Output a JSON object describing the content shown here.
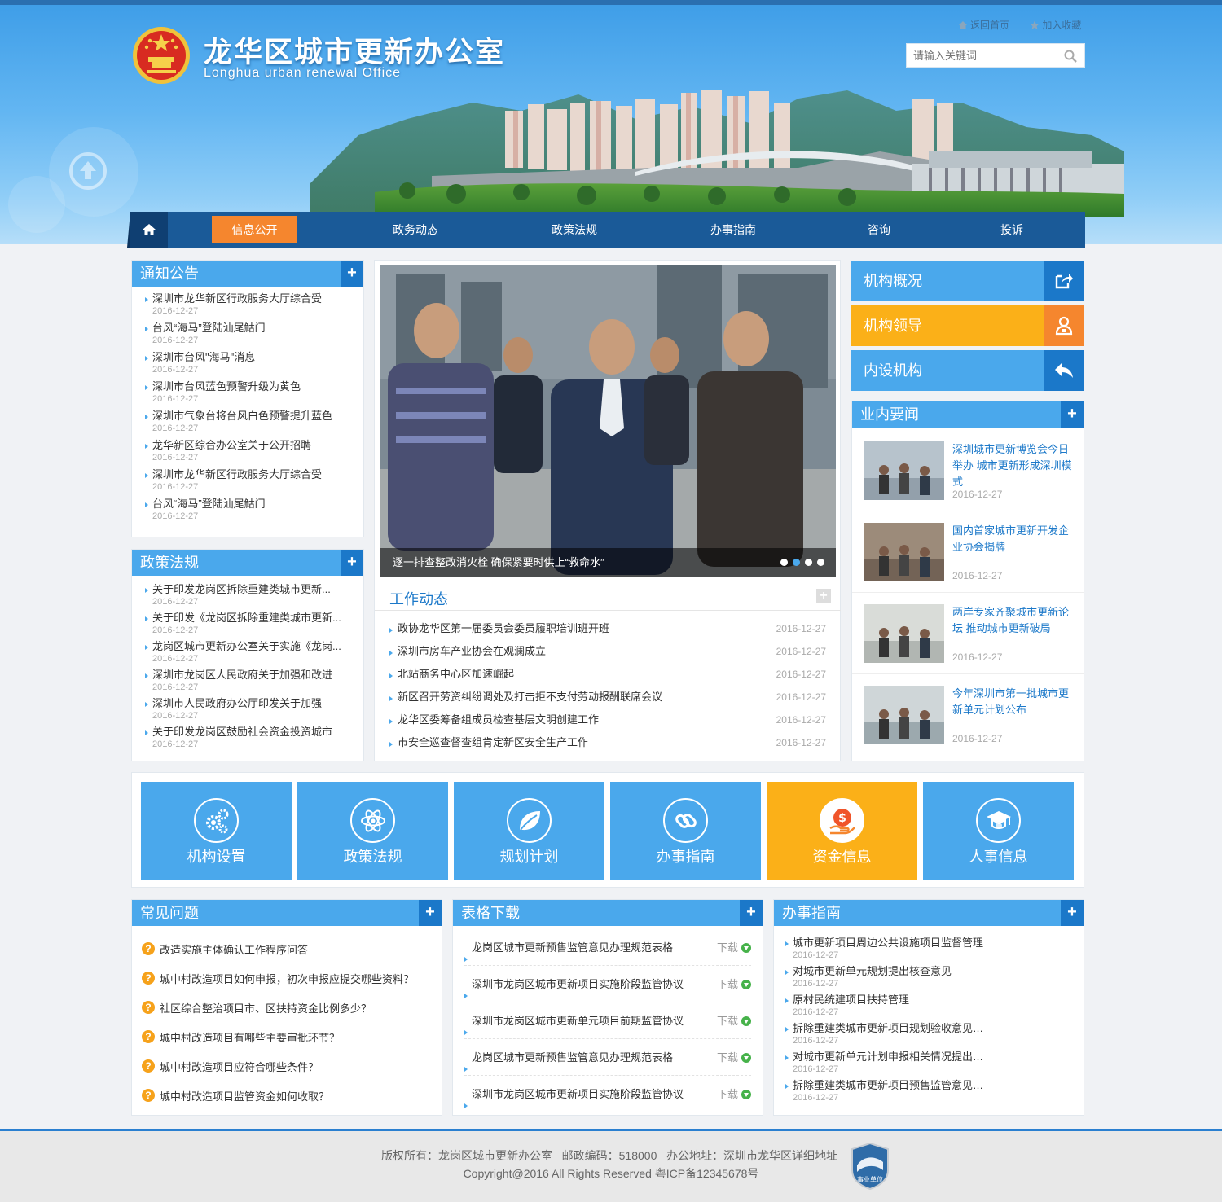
{
  "header": {
    "title": "龙华区城市更新办公室",
    "subtitle": "Longhua urban renewal Office",
    "links": {
      "home": "返回首页",
      "favorite": "加入收藏"
    },
    "search": {
      "placeholder": "请输入关键词"
    }
  },
  "nav": {
    "items": [
      "信息公开",
      "政务动态",
      "政策法规",
      "办事指南",
      "咨询",
      "投诉"
    ],
    "active": "信息公开"
  },
  "notice": {
    "title": "通知公告",
    "items": [
      {
        "title": "深圳市龙华新区行政服务大厅综合受",
        "date": "2016-12-27"
      },
      {
        "title": "台风“海马”登陆汕尾鮕门",
        "date": "2016-12-27"
      },
      {
        "title": "深圳市台风\"海马\"消息",
        "date": "2016-12-27"
      },
      {
        "title": "深圳市台风蓝色预警升级为黄色",
        "date": "2016-12-27"
      },
      {
        "title": "深圳市气象台将台风白色预警提升蓝色",
        "date": "2016-12-27"
      },
      {
        "title": "龙华新区综合办公室关于公开招聘",
        "date": "2016-12-27"
      },
      {
        "title": "深圳市龙华新区行政服务大厅综合受",
        "date": "2016-12-27"
      },
      {
        "title": "台风“海马”登陆汕尾鮕门",
        "date": "2016-12-27"
      }
    ]
  },
  "policy": {
    "title": "政策法规",
    "items": [
      {
        "title": "关于印发龙岗区拆除重建类城市更新...",
        "date": "2016-12-27"
      },
      {
        "title": "关于印发《龙岗区拆除重建类城市更新...",
        "date": "2016-12-27"
      },
      {
        "title": "龙岗区城市更新办公室关于实施《龙岗...",
        "date": "2016-12-27"
      },
      {
        "title": "深圳市龙岗区人民政府关于加强和改进",
        "date": "2016-12-27"
      },
      {
        "title": "深圳市人民政府办公厅印发关于加强",
        "date": "2016-12-27"
      },
      {
        "title": "关于印发龙岗区鼓励社会资金投资城市",
        "date": "2016-12-27"
      }
    ]
  },
  "slider": {
    "caption": "逐一排查整改消火栓 确保紧要时供上“救命水”",
    "slide_count": 4,
    "active_slide": 2
  },
  "work": {
    "title": "工作动态",
    "items": [
      {
        "title": "政协龙华区第一届委员会委员履职培训班开班",
        "date": "2016-12-27"
      },
      {
        "title": "深圳市房车产业协会在观澜成立",
        "date": "2016-12-27"
      },
      {
        "title": "北站商务中心区加速崛起",
        "date": "2016-12-27"
      },
      {
        "title": "新区召开劳资纠纷调处及打击拒不支付劳动报酬联席会议",
        "date": "2016-12-27"
      },
      {
        "title": "龙华区委筹备组成员检查基层文明创建工作",
        "date": "2016-12-27"
      },
      {
        "title": "市安全巡查督查组肯定新区安全生产工作",
        "date": "2016-12-27"
      }
    ]
  },
  "quick": [
    {
      "label": "机构概况",
      "color": "#4aa8ec",
      "iconbg": "#1b78c9",
      "icon": "share-icon"
    },
    {
      "label": "机构领导",
      "color": "#fbb018",
      "iconbg": "#f5862e",
      "icon": "leader-icon"
    },
    {
      "label": "内设机构",
      "color": "#4aa8ec",
      "iconbg": "#1b78c9",
      "icon": "reply-icon"
    }
  ],
  "industry": {
    "title": "业内要闻",
    "items": [
      {
        "title": "深圳城市更新博览会今日举办 城市更新形成深圳模式",
        "date": "2016-12-27"
      },
      {
        "title": "国内首家城市更新开发企业协会揭牌",
        "date": "2016-12-27"
      },
      {
        "title": "两岸专家齐聚城市更新论坛 推动城市更新破局",
        "date": "2016-12-27"
      },
      {
        "title": "今年深圳市第一批城市更新单元计划公布",
        "date": "2016-12-27"
      }
    ]
  },
  "tiles": [
    {
      "label": "机构设置",
      "icon": "gears-icon"
    },
    {
      "label": "政策法规",
      "icon": "atom-icon"
    },
    {
      "label": "规划计划",
      "icon": "leaf-icon"
    },
    {
      "label": "办事指南",
      "icon": "link-icon"
    },
    {
      "label": "资金信息",
      "icon": "money-icon"
    },
    {
      "label": "人事信息",
      "icon": "graduate-icon"
    }
  ],
  "colors": {
    "primary": "#4aa8ec",
    "dark": "#1b78c9",
    "accent": "#fbb018",
    "nav": "#1a5a98"
  },
  "faq": {
    "title": "常见问题",
    "items": [
      "改造实施主体确认工作程序问答",
      "城中村改造项目如何申报，初次申报应提交哪些资料？",
      "社区综合整治项目市、区扶持资金比例多少？",
      "城中村改造项目有哪些主要审批环节？",
      "城中村改造项目应符合哪些条件？",
      "城中村改造项目监管资金如何收取？"
    ]
  },
  "forms": {
    "title": "表格下载",
    "download_label": "下载",
    "items": [
      "龙岗区城市更新预售监管意见办理规范表格",
      "深圳市龙岗区城市更新项目实施阶段监管协议",
      "深圳市龙岗区城市更新单元项目前期监管协议",
      "龙岗区城市更新预售监管意见办理规范表格",
      "深圳市龙岗区城市更新项目实施阶段监管协议"
    ]
  },
  "guide": {
    "title": "办事指南",
    "items": [
      {
        "title": "城市更新项目周边公共设施项目监督管理",
        "date": "2016-12-27"
      },
      {
        "title": "对城市更新单元规划提出核查意见",
        "date": "2016-12-27"
      },
      {
        "title": "原村民统建项目扶持管理",
        "date": "2016-12-27"
      },
      {
        "title": "拆除重建类城市更新项目规划验收意见办理",
        "date": "2016-12-27"
      },
      {
        "title": "对城市更新单元计划申报相关情况提出核定意见",
        "date": "2016-12-27"
      },
      {
        "title": "拆除重建类城市更新项目预售监管意见办理",
        "date": "2016-12-27"
      }
    ]
  },
  "footer": {
    "line1": "版权所有：龙岗区城市更新办公室   邮政编码：518000   办公地址：深圳市龙华区详细地址",
    "line2": "Copyright@2016 All Rights Reserved 粤ICP备12345678号",
    "badge": "事业单位"
  }
}
